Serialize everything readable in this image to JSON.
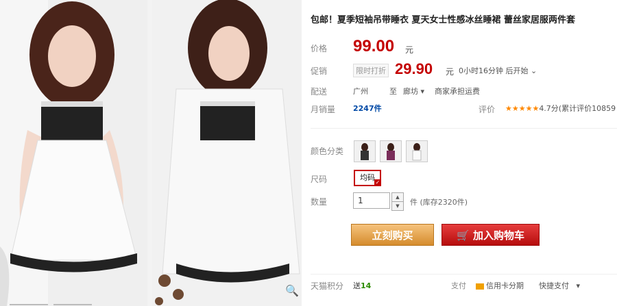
{
  "product": {
    "title": "包邮！夏季短袖吊带睡衣 夏天女士性感冰丝睡裙 蕾丝家居服两件套"
  },
  "price": {
    "label": "价格",
    "value": "99.00",
    "unit": "元"
  },
  "promo": {
    "label": "促销",
    "tag": "限时打折",
    "value": "29.90",
    "unit": "元",
    "timer": "0小时16分钟 后开始"
  },
  "delivery": {
    "label": "配送",
    "from": "广州",
    "to_label": "至",
    "to": "廊坊",
    "fee": "商家承担运费"
  },
  "sales": {
    "label": "月销量",
    "value": "2247件",
    "review_label": "评价",
    "rating": "4.7分(累计评价10859"
  },
  "color": {
    "label": "颜色分类"
  },
  "size": {
    "label": "尺码",
    "selected": "均码"
  },
  "quantity": {
    "label": "数量",
    "value": "1",
    "stock": "件 (库存2320件)"
  },
  "actions": {
    "buy": "立刻购买",
    "cart": "加入购物车"
  },
  "points": {
    "label": "天猫积分",
    "prefix": "送",
    "value": "14"
  },
  "payment": {
    "label": "支付",
    "credit": "信用卡分期",
    "express": "快捷支付"
  },
  "colors": {
    "accent": "#c40000",
    "buy": "#e0a050",
    "cart": "#c31010"
  }
}
